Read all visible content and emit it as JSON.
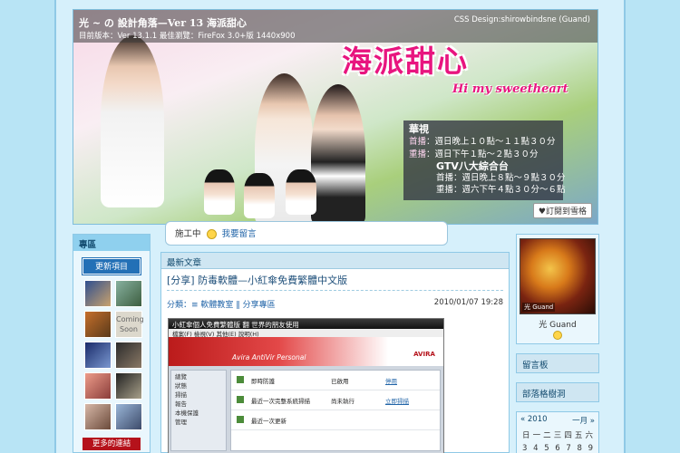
{
  "header": {
    "title": "光 ~ の 設計角落—Ver 13 海派甜心",
    "subtitle": "目前版本：Ver 13.1.1  最佳瀏覽：FireFox 3.0+版  1440x900",
    "credit": "CSS Design:shirowbindsne (Guand)",
    "show_title": "海派甜心",
    "show_tagline": "Hi my sweetheart",
    "broadcast": {
      "network1": "華視",
      "premiere_label": "首播",
      "premiere_time": "週日晚上１０點～１１點３０分",
      "rerun_label": "重播",
      "rerun_time": "週日下午１點～２點３０分",
      "network2": "GTV八大綜合台",
      "premiere2_time": "週日晚上８點～９點３０分",
      "rerun2_time": "週六下午４點３０分～６點"
    },
    "banner_button": "訂閱到雪格"
  },
  "bubble": {
    "prefix": "施工中",
    "link": "我要留言"
  },
  "left_sidebar": {
    "heading": "專區",
    "top_button": "更新項目",
    "coming_soon": "Coming Soon",
    "bottom_button": "更多的連結"
  },
  "main": {
    "section_title": "最新文章",
    "post_title": "[分享] 防毒軟體—小紅傘免費繁體中文版",
    "categories": "分類：≡ 軟體教室 ‖ 分享專區",
    "date": "2010/01/07 19:28",
    "screenshot": {
      "window_title": "小紅傘個人免費繁體版 翻 世界的朋友使用",
      "menu": "檔案(F)   檢視(V)   其他(E)   說明(H)",
      "product": "Avira AntiVir Personal",
      "logo": "AVIRA",
      "side_items": [
        "總覽",
        "狀態",
        "掃描",
        "報告",
        "本機保護",
        "管理"
      ],
      "rows": [
        {
          "name": "即時防護",
          "status": "已啟用",
          "action": "停用"
        },
        {
          "name": "最近一次完整系統掃描",
          "status": "尚未執行",
          "action": "立即掃描"
        },
        {
          "name": "最近一次更新",
          "status": "",
          "action": ""
        }
      ]
    }
  },
  "right_sidebar": {
    "profile_name": "光 Guand",
    "avatar_tag": "光 Guand",
    "box1": "留言板",
    "box2": "部落格樹洞",
    "calendar": {
      "prev": "« 2010",
      "next": "一月 »",
      "days": [
        "日",
        "一",
        "二",
        "三",
        "四",
        "五",
        "六"
      ],
      "week": [
        "3",
        "4",
        "5",
        "6",
        "7",
        "8",
        "9"
      ]
    }
  }
}
